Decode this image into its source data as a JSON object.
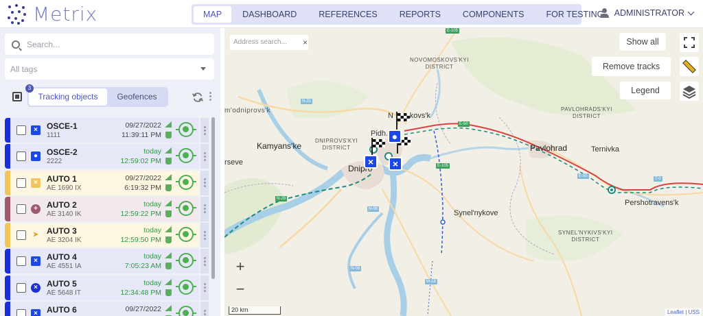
{
  "app": {
    "logo_text": "Metrix"
  },
  "nav": {
    "items": [
      {
        "label": "MAP",
        "active": true
      },
      {
        "label": "DASHBOARD"
      },
      {
        "label": "REFERENCES"
      },
      {
        "label": "REPORTS"
      },
      {
        "label": "COMPONENTS"
      },
      {
        "label": "FOR TESTING"
      }
    ]
  },
  "user": {
    "name": "ADMINISTRATOR",
    "icon": "user-icon"
  },
  "sidebar": {
    "search_placeholder": "Search...",
    "tags_placeholder": "All tags",
    "tabs": [
      {
        "label": "Tracking objects",
        "active": true
      },
      {
        "label": "Geofences"
      }
    ],
    "badge_count": "3",
    "objects": [
      {
        "name": "OSCE-1",
        "sub": "1111",
        "date": "09/27/2022",
        "time": "11:39:11 PM",
        "fresh": false,
        "bar": "#1b2fd8",
        "bg": "#e6e8f7",
        "icon_bg": "#1b46e8",
        "icon": "×",
        "round": false,
        "checked": false
      },
      {
        "name": "OSCE-2",
        "sub": "2222",
        "date": "today",
        "time": "12:59:02 PM",
        "fresh": true,
        "bar": "#1b2fd8",
        "bg": "#e6e8f7",
        "icon_bg": "#1b46e8",
        "icon": "●",
        "round": false,
        "checked": false
      },
      {
        "name": "AUTO 1",
        "sub": "AE 1690 IX",
        "date": "09/27/2022",
        "time": "6:19:32 PM",
        "fresh": false,
        "bar": "#f2c45c",
        "bg": "#fdf6e0",
        "icon_bg": "#f2c45c",
        "icon": "×",
        "round": false,
        "checked": false
      },
      {
        "name": "AUTO 2",
        "sub": "AE 3140 IK",
        "date": "today",
        "time": "12:59:22 PM",
        "fresh": true,
        "bar": "#a05a6e",
        "bg": "#f1e9ee",
        "icon_bg": "#a05a6e",
        "icon": "+",
        "round": true,
        "checked": false
      },
      {
        "name": "AUTO 3",
        "sub": "AE 3204 IK",
        "date": "today",
        "time": "12:59:50 PM",
        "fresh": true,
        "bar": "#f2c45c",
        "bg": "#fdf6e0",
        "icon_bg": "#fdf6e0",
        "icon": "➤",
        "round": false,
        "checked": false
      },
      {
        "name": "AUTO 4",
        "sub": "AE 4551 IA",
        "date": "today",
        "time": "7:05:23 AM",
        "fresh": true,
        "bar": "#1b2fd8",
        "bg": "#e6e8f7",
        "icon_bg": "#1b46e8",
        "icon": "×",
        "round": false,
        "checked": false
      },
      {
        "name": "AUTO 5",
        "sub": "AE 5648 IT",
        "date": "today",
        "time": "12:34:48 PM",
        "fresh": true,
        "bar": "#1b2fd8",
        "bg": "#e6e8f7",
        "icon_bg": "#1b2fd8",
        "icon": "×",
        "round": true,
        "checked": false
      },
      {
        "name": "AUTO 6",
        "sub": "",
        "date": "09/27/2022",
        "time": "",
        "fresh": false,
        "bar": "#1b2fd8",
        "bg": "#e6e8f7",
        "icon_bg": "#1b46e8",
        "icon": "×",
        "round": false,
        "checked": false
      }
    ]
  },
  "map": {
    "address_placeholder": "Address search...",
    "show_all": "Show all",
    "remove_tracks": "Remove tracks",
    "legend": "Legend",
    "zoom_in": "+",
    "zoom_out": "−",
    "scale": "20 km",
    "attribution_1": "Leaflet",
    "attribution_2": " | USS",
    "places": [
      {
        "label": "Kamyans'ke",
        "big": true
      },
      {
        "label": "Dnipro",
        "big": true
      },
      {
        "label": "Pavlohrad",
        "big": true
      },
      {
        "label": "Ternivka"
      },
      {
        "label": "Synel'nykove"
      },
      {
        "label": "Pershotravens'k"
      },
      {
        "label": "N ...oskovs'k"
      },
      {
        "label": "Pidh..."
      },
      {
        "label": "rseve"
      }
    ],
    "districts": [
      {
        "label": "NOVOMOSKOVS'KYI\nDISTRICT"
      },
      {
        "label": "PAVLOHRADS'KYI\nDISTRICT"
      },
      {
        "label": "DNIPROVS'KYI\nDISTRICT"
      },
      {
        "label": "SYNEL'NYKIVS'KYI\nDISTRICT"
      },
      {
        "label": "m'odniprovs'k"
      }
    ],
    "roads": [
      "E-105",
      "N-31",
      "E-50",
      "E-50",
      "N-29",
      "N-08",
      "M-18",
      "N-08",
      "T-0",
      "E-105"
    ]
  },
  "colors": {
    "accent": "#4a55b8",
    "nav_bg": "#dfe2f6",
    "route_red": "#d94040",
    "track_teal": "#1a8a7a",
    "marker_blue": "#1b46e8"
  }
}
